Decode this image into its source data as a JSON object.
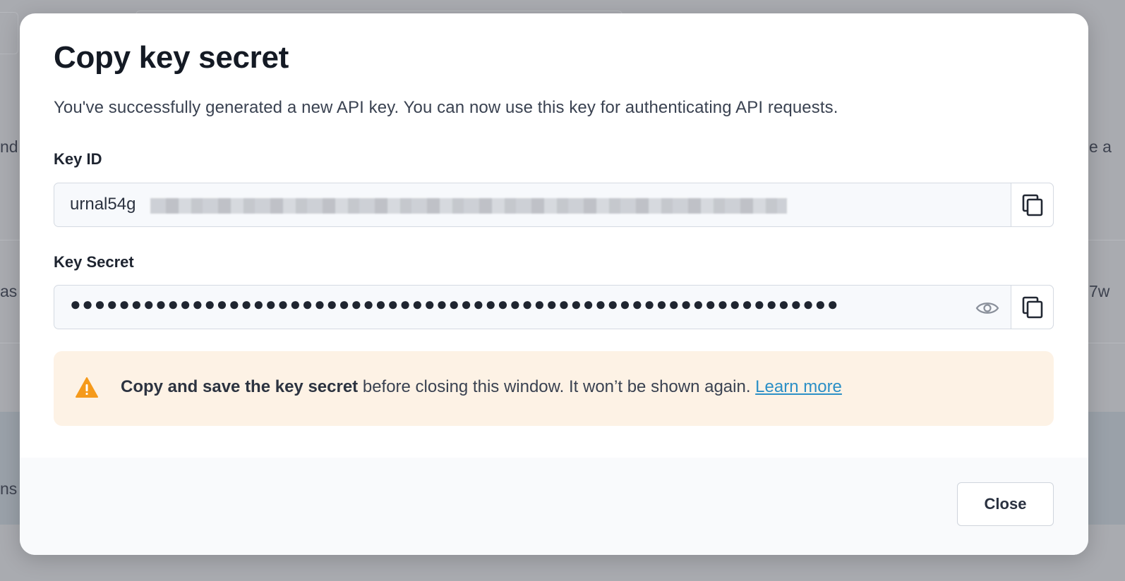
{
  "background": {
    "fragments": [
      "nd",
      "as",
      "ns",
      "e a",
      "7w"
    ]
  },
  "modal": {
    "title": "Copy key secret",
    "description": "You've successfully generated a new API key. You can now use this key for authenticating API requests.",
    "key_id": {
      "label": "Key ID",
      "value": "urnal54g",
      "copy_icon": "copy-icon"
    },
    "key_secret": {
      "label": "Key Secret",
      "value": "●●●●●●●●●●●●●●●●●●●●●●●●●●●●●●●●●●●●●●●●●●●●●●●●●●●●●●●●●●●●●●●",
      "reveal_icon": "eye-icon",
      "copy_icon": "copy-icon"
    },
    "alert": {
      "icon": "warning-icon",
      "bold": "Copy and save the key secret",
      "text": " before closing this window. It won’t be shown again. ",
      "link": "Learn more",
      "color": "#f59a1b"
    },
    "close_label": "Close"
  }
}
